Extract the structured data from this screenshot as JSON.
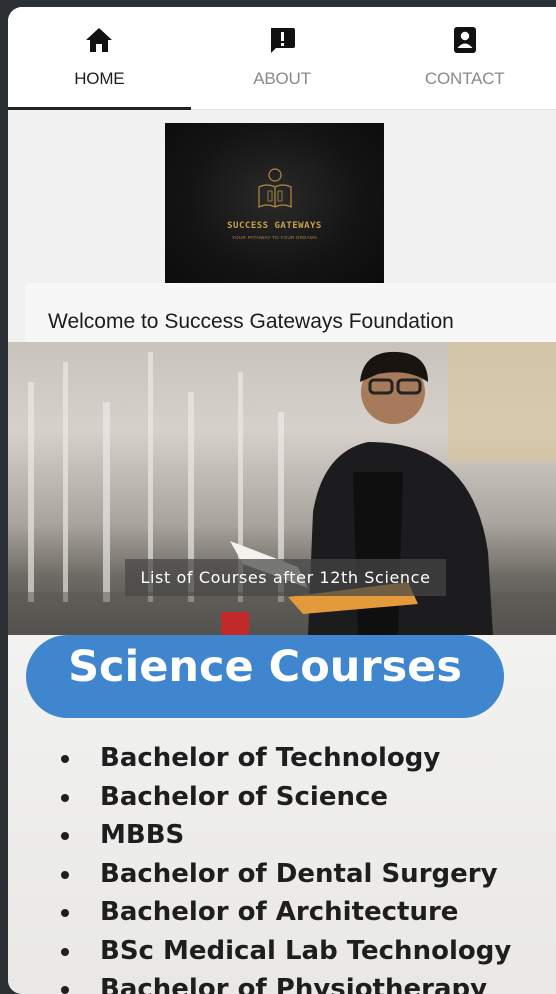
{
  "nav": {
    "tabs": [
      {
        "label": "HOME",
        "icon": "home-icon",
        "active": true
      },
      {
        "label": "ABOUT",
        "icon": "about-icon",
        "active": false
      },
      {
        "label": "CONTACT",
        "icon": "contact-icon",
        "active": false
      }
    ]
  },
  "logo": {
    "title": "SUCCESS GATEWAYS",
    "subtitle": "YOUR PATHWAY TO YOUR DREAMS"
  },
  "welcome": "Welcome to Success Gateways Foundation",
  "banner": {
    "caption": "List of Courses after 12th Science"
  },
  "courses": {
    "heading": "Science Courses",
    "items": [
      "Bachelor of Technology",
      "Bachelor of Science",
      "MBBS",
      "Bachelor of Dental Surgery",
      "Bachelor of Architecture",
      "BSc Medical Lab Technology",
      "Bachelor of Physiotherapy"
    ]
  },
  "colors": {
    "page_bg": "#2c3034",
    "content_bg": "#f1f1f1",
    "accent_blue": "#3f86cf",
    "logo_gold": "#c9a14a"
  }
}
